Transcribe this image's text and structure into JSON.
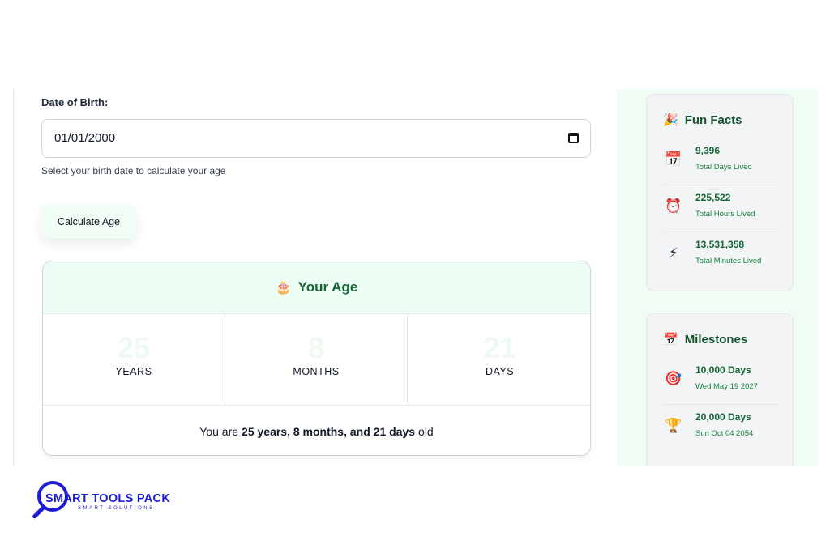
{
  "form": {
    "dob_label": "Date of Birth:",
    "dob_value": "01/01/2000",
    "dob_help": "Select your birth date to calculate your age",
    "calculate_label": "Calculate Age"
  },
  "result": {
    "icon": "cake-icon",
    "title": "Your Age",
    "years": "25",
    "years_unit": "YEARS",
    "months": "8",
    "months_unit": "MONTHS",
    "days": "21",
    "days_unit": "DAYS",
    "summary_prefix": "You are",
    "summary_bold": "25 years, 8 months, and 21 days",
    "summary_suffix": "old"
  },
  "fun_facts": {
    "icon": "party-popper-icon",
    "title": "Fun Facts",
    "items": [
      {
        "icon": "calendar-icon",
        "value": "9,396",
        "label": "Total Days Lived"
      },
      {
        "icon": "alarm-clock-icon",
        "value": "225,522",
        "label": "Total Hours Lived"
      },
      {
        "icon": "lightning-icon",
        "value": "13,531,358",
        "label": "Total Minutes Lived"
      }
    ]
  },
  "milestones": {
    "icon": "calendar-icon",
    "title": "Milestones",
    "items": [
      {
        "icon": "target-icon",
        "value": "10,000 Days",
        "label": "Wed May 19 2027"
      },
      {
        "icon": "trophy-icon",
        "value": "20,000 Days",
        "label": "Sun Oct 04 2054"
      }
    ]
  },
  "logo": {
    "title": "SMART TOOLS PACK",
    "subtitle": "SMART SOLUTIONS"
  },
  "colors": {
    "accent": "#166534",
    "panel": "#f0fdf4",
    "logo": "#1d1bd6"
  }
}
